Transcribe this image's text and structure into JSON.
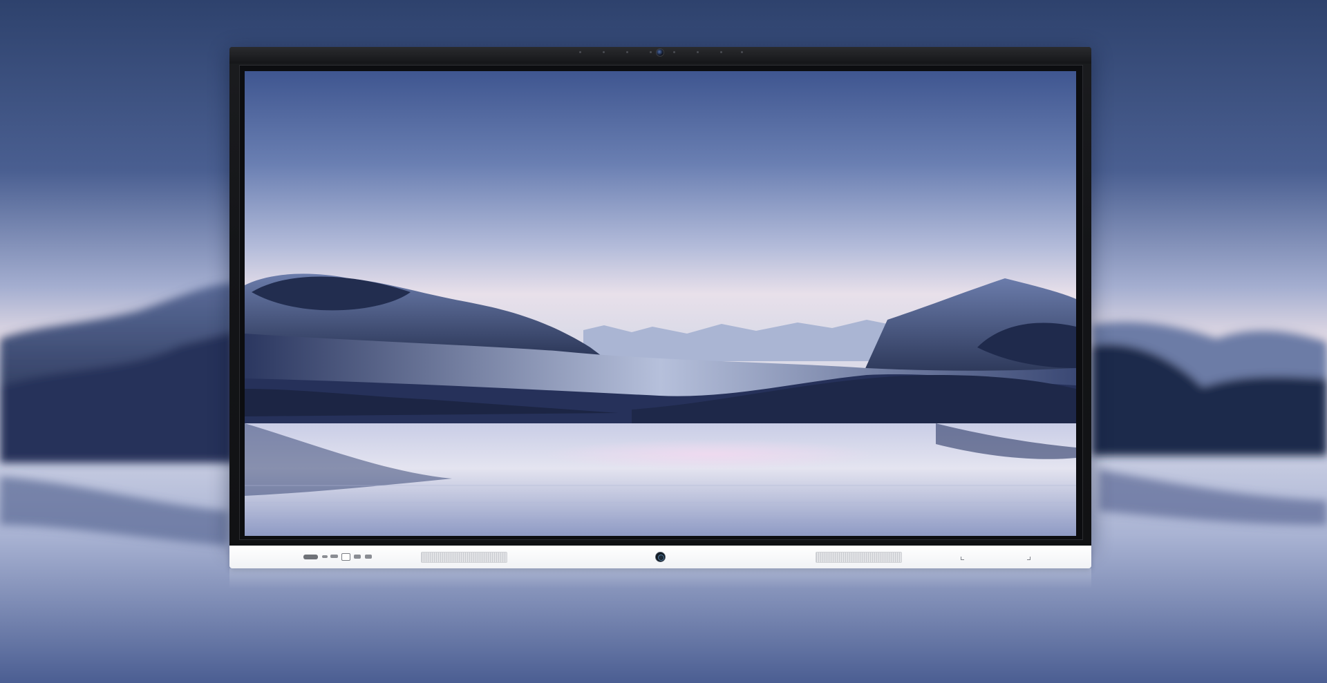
{
  "scene": {
    "subject": "interactive-display-panel",
    "wallpaper": "desert-dunes-over-water",
    "colors": {
      "sky_top": "#2e426d",
      "sky_mid": "#8797c1",
      "horizon_glow": "#e7dde6",
      "dune_dark": "#1f2a48",
      "dune_light": "#b7c2dc",
      "water": "#c3c9e0",
      "bezel": "#141518",
      "chin": "#ffffff"
    }
  },
  "device": {
    "bezel_icons": {
      "webcam": "webcam-icon",
      "power": "power-button-icon"
    },
    "front_ports": [
      "usb-c-port",
      "usb-a-port",
      "hdmi-port",
      "touch-port",
      "usb-port-1",
      "usb-port-2"
    ],
    "port_labels": [
      "",
      "",
      "",
      "",
      "",
      ""
    ]
  }
}
